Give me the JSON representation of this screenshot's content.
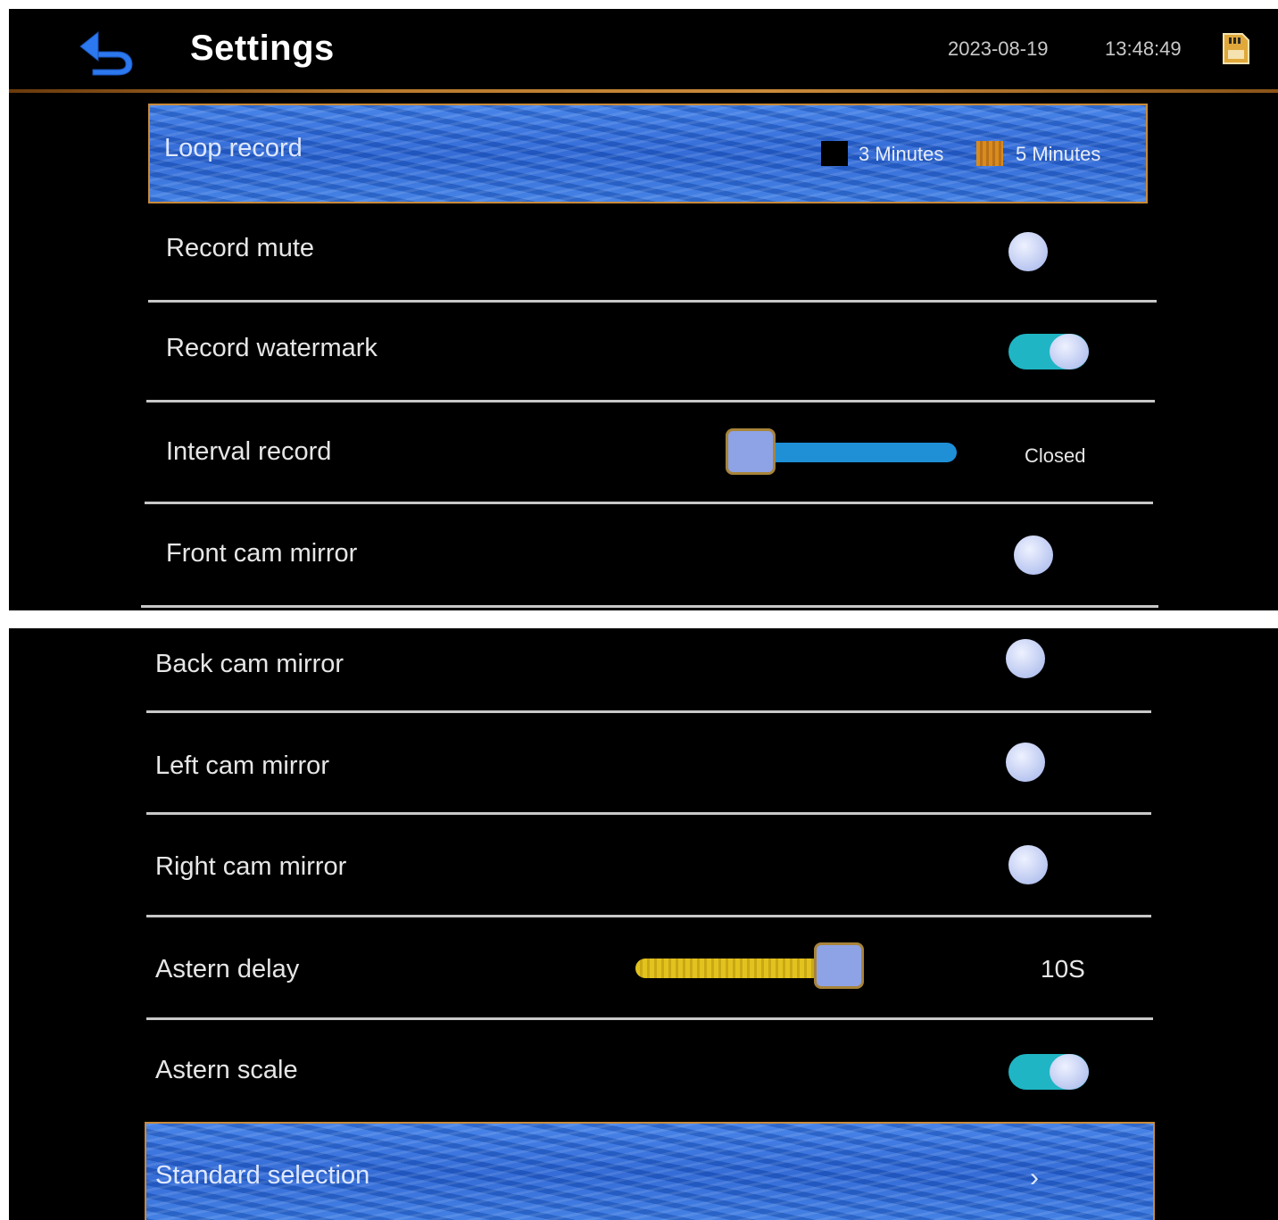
{
  "header": {
    "title": "Settings",
    "date": "2023-08-19",
    "time": "13:48:49",
    "back_icon": "back-arrow-icon",
    "storage_icon": "sd-card-icon"
  },
  "settings": {
    "loop_record": {
      "label": "Loop record",
      "options": [
        "3 Minutes",
        "5 Minutes"
      ],
      "selected": "5 Minutes"
    },
    "record_mute": {
      "label": "Record mute",
      "state": "off"
    },
    "record_watermark": {
      "label": "Record watermark",
      "state": "on"
    },
    "interval_record": {
      "label": "Interval record",
      "value": "Closed",
      "level": 0
    },
    "front_cam_mirror": {
      "label": "Front cam mirror",
      "state": "off"
    },
    "back_cam_mirror": {
      "label": "Back cam mirror",
      "state": "off"
    },
    "left_cam_mirror": {
      "label": "Left cam mirror",
      "state": "off"
    },
    "right_cam_mirror": {
      "label": "Right cam mirror",
      "state": "off"
    },
    "astern_delay": {
      "label": "Astern delay",
      "value": "10S",
      "level": 1.0
    },
    "astern_scale": {
      "label": "Astern scale",
      "state": "on"
    },
    "standard_selection": {
      "label": "Standard selection",
      "chevron": "chevron-right-icon"
    }
  },
  "colors": {
    "toggle_on": "#1fb5c4",
    "slider_blue": "#1f8fd6",
    "slider_yellow": "#e2c21e",
    "header_line": "#b87a2e",
    "selected_option": "#d98c1c"
  }
}
